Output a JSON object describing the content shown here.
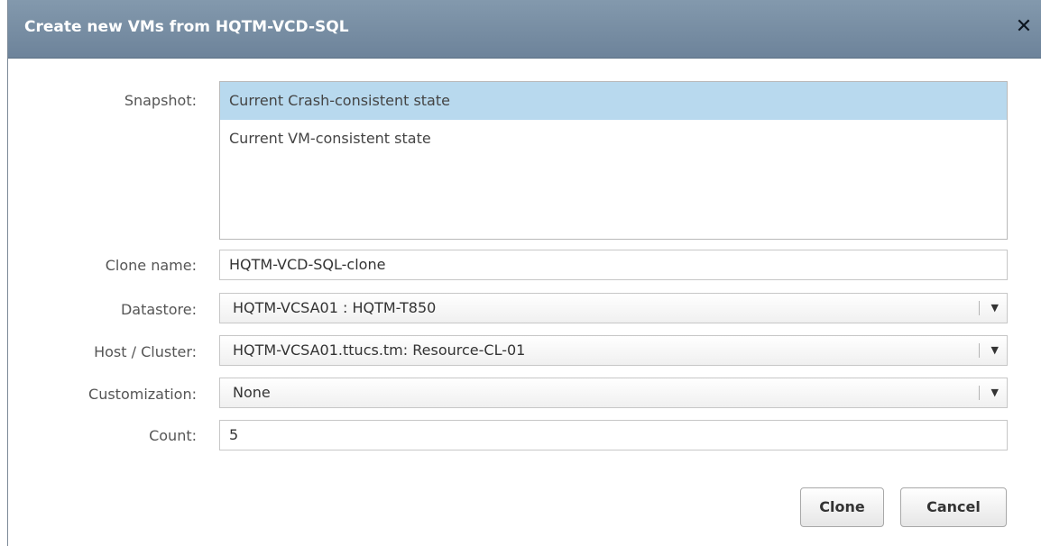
{
  "dialog": {
    "title": "Create new VMs from HQTM-VCD-SQL",
    "close_glyph": "✕"
  },
  "form": {
    "snapshot": {
      "label": "Snapshot:",
      "options": [
        "Current Crash-consistent state",
        "Current VM-consistent state"
      ],
      "selected_index": 0
    },
    "clone_name": {
      "label": "Clone name:",
      "value": "HQTM-VCD-SQL-clone"
    },
    "datastore": {
      "label": "Datastore:",
      "value": "HQTM-VCSA01 : HQTM-T850"
    },
    "host_cluster": {
      "label": "Host / Cluster:",
      "value": "HQTM-VCSA01.ttucs.tm: Resource-CL-01"
    },
    "customization": {
      "label": "Customization:",
      "value": "None"
    },
    "count": {
      "label": "Count:",
      "value": "5"
    }
  },
  "buttons": {
    "clone": "Clone",
    "cancel": "Cancel"
  },
  "icons": {
    "dropdown_arrow": "▼"
  },
  "colors": {
    "titlebar": "#7a90a5",
    "selection": "#b8d9ee"
  }
}
